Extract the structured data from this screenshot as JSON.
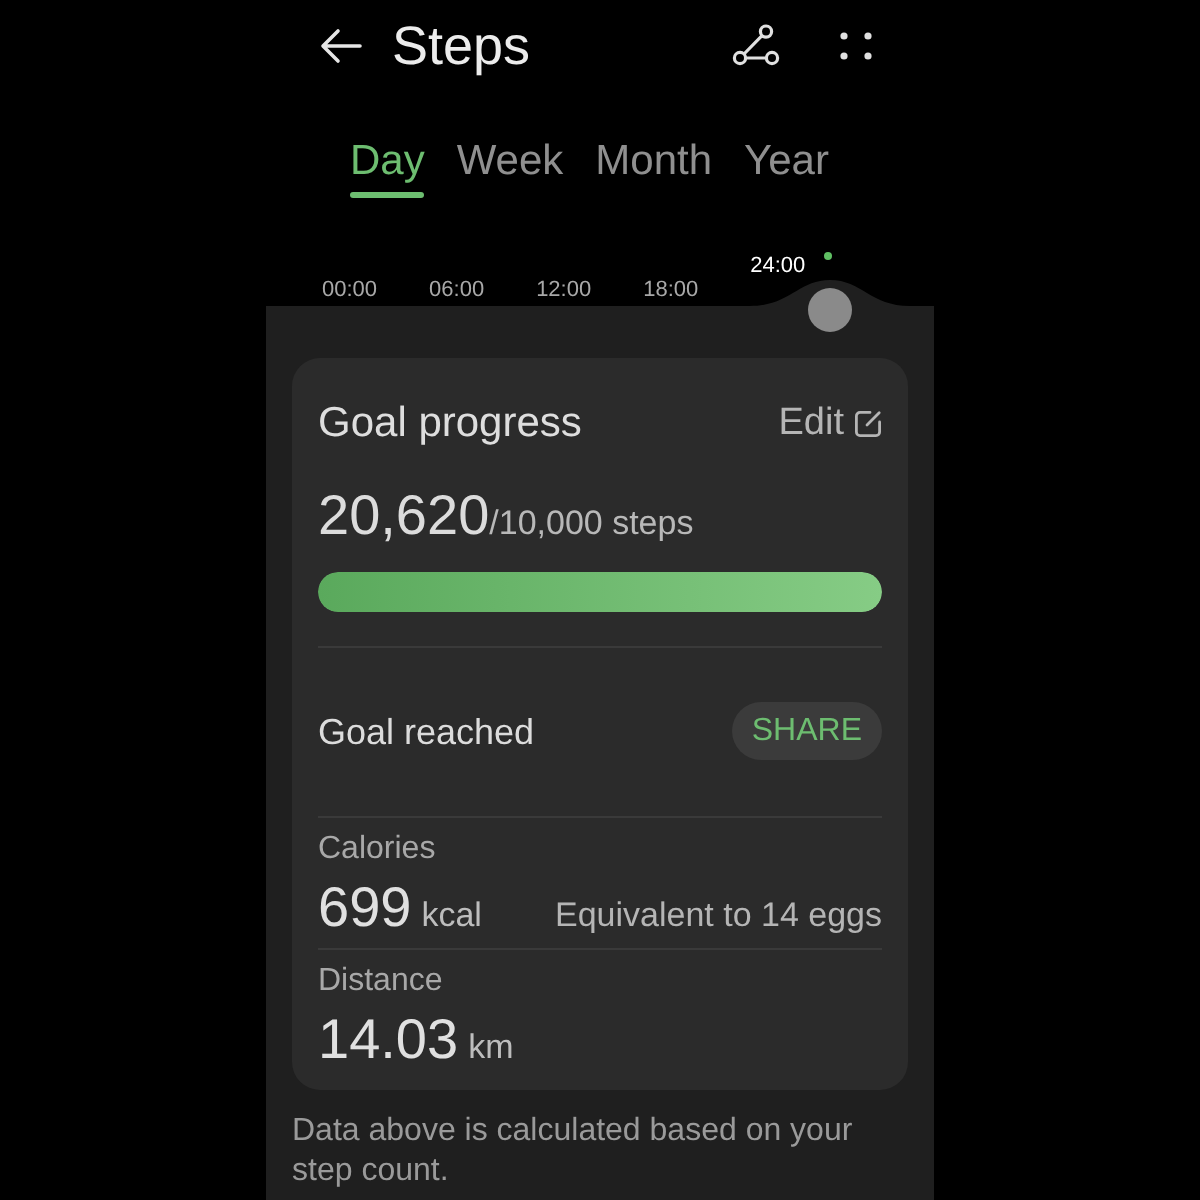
{
  "header": {
    "title": "Steps"
  },
  "tabs": [
    {
      "label": "Day",
      "selected": true
    },
    {
      "label": "Week",
      "selected": false
    },
    {
      "label": "Month",
      "selected": false
    },
    {
      "label": "Year",
      "selected": false
    }
  ],
  "timeline": {
    "ticks": [
      "00:00",
      "06:00",
      "12:00",
      "18:00"
    ],
    "current_time": "24:00"
  },
  "goal_card": {
    "title": "Goal progress",
    "edit_label": "Edit",
    "steps": "20,620",
    "goal": "/10,000 steps",
    "level": 1,
    "status": "Goal reached",
    "share_label": "SHARE",
    "metrics": [
      {
        "label": "Calories",
        "value": "699",
        "unit": "kcal",
        "note": "Equivalent to 14 eggs"
      },
      {
        "label": "Distance",
        "value": "14.03",
        "unit": "km"
      }
    ]
  },
  "footnote": "Data above is calculated based on your step count."
}
